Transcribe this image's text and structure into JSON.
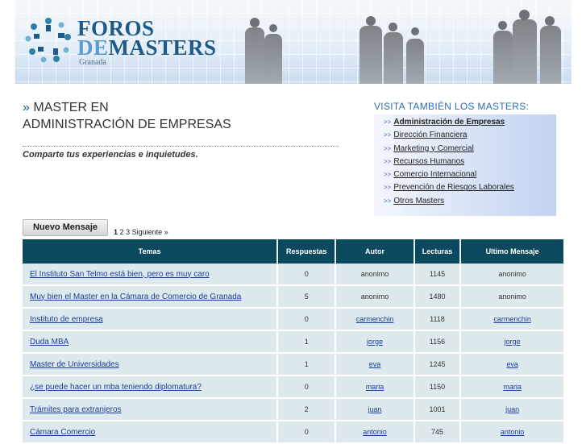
{
  "header": {
    "logo_line1": "FOROS",
    "logo_de": "DE",
    "logo_line2_rest": "MASTERS",
    "logo_city": "Granada"
  },
  "page": {
    "arrow": "»",
    "title_line1": "MASTER EN",
    "title_line2": "ADMINISTRACIÓN DE EMPRESAS",
    "subtitle": "Comparte tus experiencias e inquietudes."
  },
  "sidebar": {
    "title": "VISITA TAMBIÉN LOS MASTERS:",
    "bullet": ">>",
    "items": [
      {
        "label": "Administración de Empresas"
      },
      {
        "label": "Dirección Financiera"
      },
      {
        "label": "Marketing y Comercial"
      },
      {
        "label": "Recursos Humanos"
      },
      {
        "label": "Comercio Internacional"
      },
      {
        "label": "Prevención de Riesgos Laborales"
      },
      {
        "label": "Otros Masters"
      }
    ]
  },
  "toolbar": {
    "new_message": "Nuevo Mensaje",
    "pages": [
      "1",
      "2",
      "3"
    ],
    "next": "Siguiente",
    "next_arrow": "»"
  },
  "table": {
    "headers": [
      "Temas",
      "Respuestas",
      "Autor",
      "Lecturas",
      "Ultimo Mensaje"
    ],
    "rows": [
      {
        "topic": "El Instituto San Telmo está bien, pero es muy caro",
        "replies": "0",
        "author": "anonimo",
        "author_link": false,
        "reads": "1145",
        "last": "anonimo",
        "last_link": false
      },
      {
        "topic": "Muy bien el Master en la Cámara de Comercio de Granada",
        "replies": "5",
        "author": "anonimo",
        "author_link": false,
        "reads": "1480",
        "last": "anonimo",
        "last_link": false
      },
      {
        "topic": "Instituto de empresa",
        "replies": "0",
        "author": "carmenchin",
        "author_link": true,
        "reads": "1118",
        "last": "carmenchin",
        "last_link": true
      },
      {
        "topic": "Duda MBA",
        "replies": "1",
        "author": "jorge",
        "author_link": true,
        "reads": "1156",
        "last": "jorge",
        "last_link": true
      },
      {
        "topic": "Master de Universidades",
        "replies": "1",
        "author": "eva",
        "author_link": true,
        "reads": "1245",
        "last": "eva",
        "last_link": true
      },
      {
        "topic": "¿se puede hacer un mba teniendo diplomatura?",
        "replies": "0",
        "author": "maria",
        "author_link": true,
        "reads": "1150",
        "last": "maria",
        "last_link": true
      },
      {
        "topic": "Trámites para extranjeros",
        "replies": "2",
        "author": "juan",
        "author_link": true,
        "reads": "1001",
        "last": "juan",
        "last_link": true
      },
      {
        "topic": "Cámara Comercio",
        "replies": "0",
        "author": "antonio",
        "author_link": true,
        "reads": "745",
        "last": "antonio",
        "last_link": true
      }
    ]
  },
  "colors": {
    "header_bg": "#0b4a5e",
    "row_bg": "#dde9ec",
    "link": "#1a3f9a",
    "accent": "#2f6db3"
  }
}
